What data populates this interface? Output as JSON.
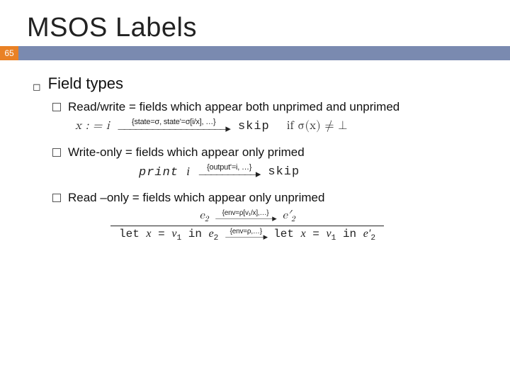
{
  "slide": {
    "title": "MSOS Labels",
    "page_number": "65"
  },
  "bullet1": {
    "text": "Field types"
  },
  "sub1": {
    "text": "Read/write = fields which appear both unprimed and unprimed",
    "formula": {
      "lhs": "x : = i",
      "arrow_label": "{state=σ, state'=σ[i/x], …}",
      "rhs": "skip",
      "cond": "if σ(x) ≠ ⊥"
    }
  },
  "sub2": {
    "text": "Write-only = fields which appear only primed",
    "formula": {
      "lhs": "print i",
      "arrow_label": "{output'=i, …}",
      "rhs": "skip"
    }
  },
  "sub3": {
    "text": "Read –only = fields which appear only unprimed",
    "rule": {
      "top_lhs": "e₂",
      "top_label": "{env=ρ[v₁/x],…}",
      "top_rhs": "e′₂",
      "bot_lhs": "let x = v₁ in e₂",
      "bot_label": "{env=ρ,…}",
      "bot_rhs": "let x = v₁ in e′₂"
    }
  }
}
